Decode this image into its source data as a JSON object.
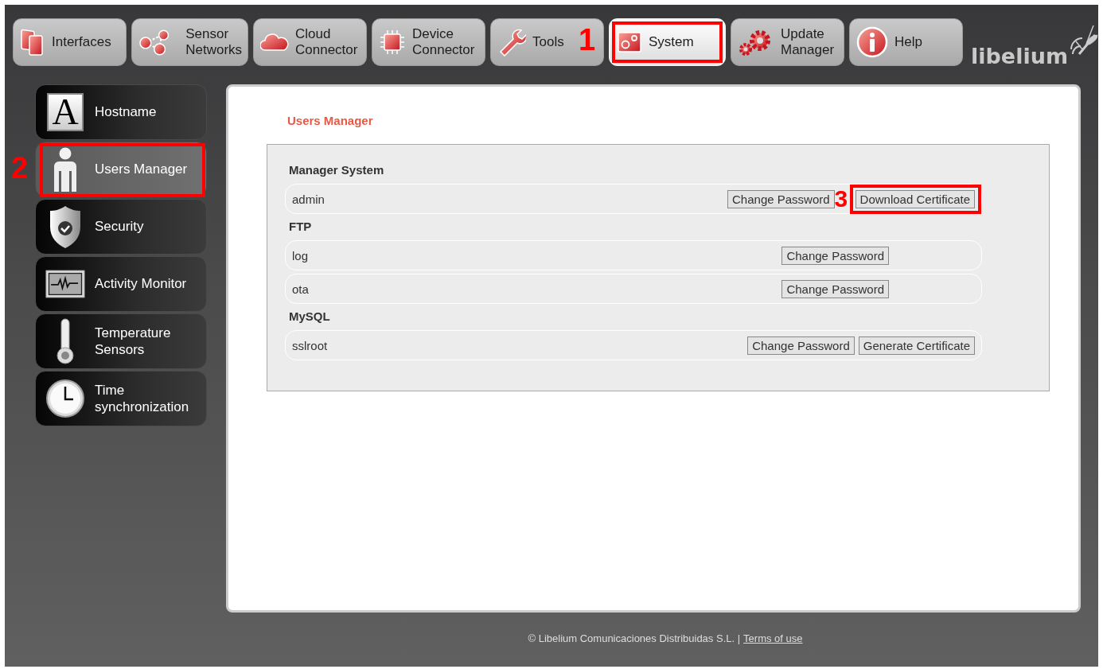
{
  "nav": {
    "tabs": [
      {
        "label": "Interfaces",
        "selected": false
      },
      {
        "label": "Sensor Networks",
        "selected": false
      },
      {
        "label": "Cloud Connector",
        "selected": false
      },
      {
        "label": "Device Connector",
        "selected": false
      },
      {
        "label": "Tools",
        "selected": false
      },
      {
        "label": "System",
        "selected": true,
        "annotation": "1"
      },
      {
        "label": "Update Manager",
        "selected": false
      },
      {
        "label": "Help",
        "selected": false
      }
    ],
    "logo": "libelium"
  },
  "sidebar": {
    "items": [
      {
        "label": "Hostname",
        "selected": false,
        "icon_letter": "A"
      },
      {
        "label": "Users Manager",
        "selected": true,
        "annotation": "2"
      },
      {
        "label": "Security",
        "selected": false
      },
      {
        "label": "Activity Monitor",
        "selected": false
      },
      {
        "label": "Temperature Sensors",
        "selected": false
      },
      {
        "label": "Time synchronization",
        "selected": false
      }
    ]
  },
  "content": {
    "title": "Users Manager",
    "sections": [
      {
        "heading": "Manager System",
        "rows": [
          {
            "user": "admin",
            "buttons": [
              {
                "label": "Change Password"
              },
              {
                "label": "Download Certificate",
                "annotation": "3"
              }
            ]
          }
        ]
      },
      {
        "heading": "FTP",
        "rows": [
          {
            "user": "log",
            "buttons": [
              {
                "label": "Change Password"
              }
            ]
          },
          {
            "user": "ota",
            "buttons": [
              {
                "label": "Change Password"
              }
            ]
          }
        ]
      },
      {
        "heading": "MySQL",
        "rows": [
          {
            "user": "sslroot",
            "buttons": [
              {
                "label": "Change Password"
              },
              {
                "label": "Generate Certificate"
              }
            ]
          }
        ]
      }
    ]
  },
  "footer": {
    "copyright": "© Libelium Comunicaciones Distribuidas S.L. |",
    "link": "Terms of use"
  }
}
